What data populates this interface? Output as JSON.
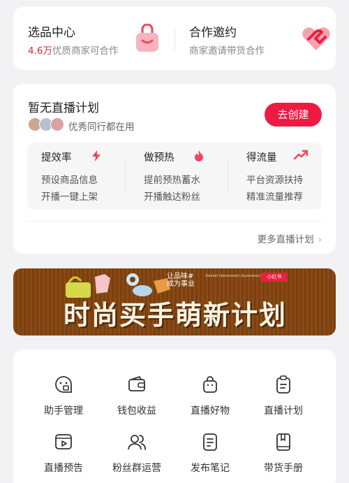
{
  "top_card": {
    "selection": {
      "title": "选品中心",
      "highlight": "4.6万",
      "subtitle": "优质商家可合作",
      "icon": "shopping-bag-icon",
      "icon_color": "#f7a7b2"
    },
    "cooperation": {
      "title": "合作邀约",
      "subtitle": "商家邀请带货合作",
      "icon": "handshake-heart-icon",
      "icon_color": "#ef4a5e"
    }
  },
  "plan": {
    "title": "暂无直播计划",
    "subtitle": "优秀同行都在用",
    "create_label": "去创建",
    "features": [
      {
        "title": "提效率",
        "icon": "lightning-icon",
        "lines": [
          "预设商品信息",
          "开播一键上架"
        ]
      },
      {
        "title": "做预热",
        "icon": "flame-icon",
        "lines": [
          "提前预热蓄水",
          "开播触达粉丝"
        ]
      },
      {
        "title": "得流量",
        "icon": "trend-up-icon",
        "lines": [
          "平台资源扶持",
          "精准流量推荐"
        ]
      }
    ],
    "more_label": "更多直播计划"
  },
  "banner": {
    "tagline_1": "让品味#",
    "tagline_2": "成为事业",
    "english": "(taste)  (becomes)  (business)",
    "badge": "小红书",
    "title": "时尚买手萌新计划"
  },
  "tools": [
    {
      "label": "助手管理",
      "icon": "assistant-face-icon"
    },
    {
      "label": "钱包收益",
      "icon": "wallet-icon"
    },
    {
      "label": "直播好物",
      "icon": "bag-icon"
    },
    {
      "label": "直播计划",
      "icon": "clipboard-icon"
    },
    {
      "label": "直播预告",
      "icon": "video-play-icon"
    },
    {
      "label": "粉丝群运营",
      "icon": "fans-group-icon"
    },
    {
      "label": "发布笔记",
      "icon": "note-icon"
    },
    {
      "label": "带货手册",
      "icon": "handbook-icon"
    }
  ],
  "colors": {
    "accent": "#ef1a42",
    "banner": "#8a4a14"
  }
}
